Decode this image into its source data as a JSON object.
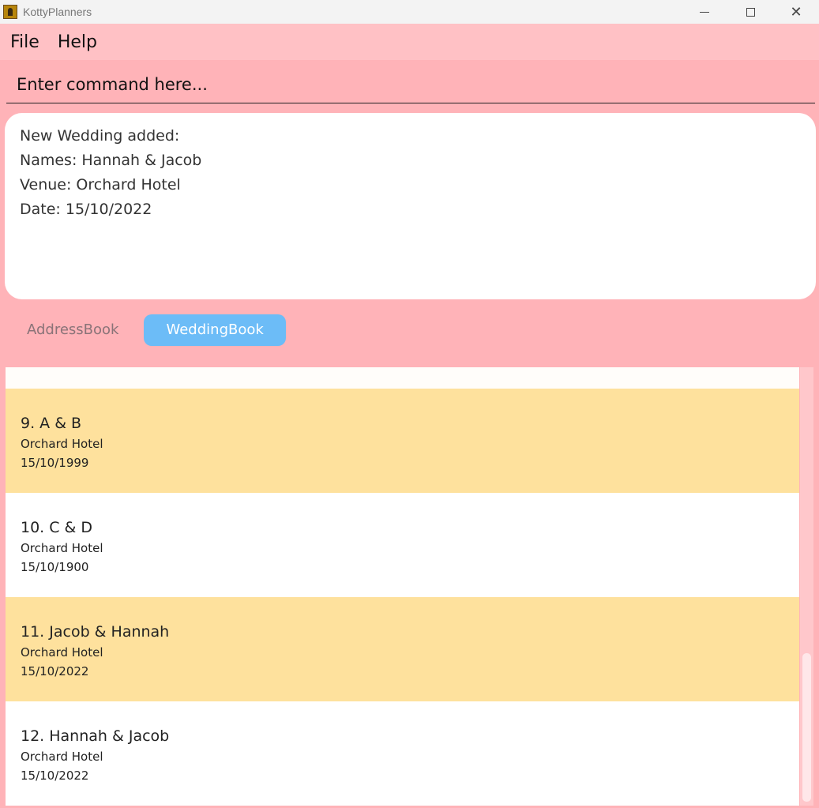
{
  "window": {
    "title": "KottyPlanners",
    "controls": {
      "minimize": "",
      "maximize": "",
      "close": "✕"
    }
  },
  "menu": {
    "file": "File",
    "help": "Help"
  },
  "command": {
    "placeholder": "Enter command here..."
  },
  "result": {
    "lines": [
      "New Wedding added:",
      "Names: Hannah & Jacob",
      "Venue: Orchard Hotel",
      "Date: 15/10/2022"
    ]
  },
  "tabs": {
    "address_book": "AddressBook",
    "wedding_book": "WeddingBook",
    "active": "WeddingBook"
  },
  "weddings": [
    {
      "title": "9. A & B",
      "venue": "Orchard Hotel",
      "date": "15/10/1999"
    },
    {
      "title": "10. C & D",
      "venue": "Orchard Hotel",
      "date": "15/10/1900"
    },
    {
      "title": "11. Jacob & Hannah",
      "venue": "Orchard Hotel",
      "date": "15/10/2022"
    },
    {
      "title": "12. Hannah & Jacob",
      "venue": "Orchard Hotel",
      "date": "15/10/2022"
    }
  ],
  "colors": {
    "background": "#ffb3b8",
    "menubar": "#ffc1c5",
    "card_highlight": "#fee19d",
    "tab_active": "#6cbcf7"
  }
}
